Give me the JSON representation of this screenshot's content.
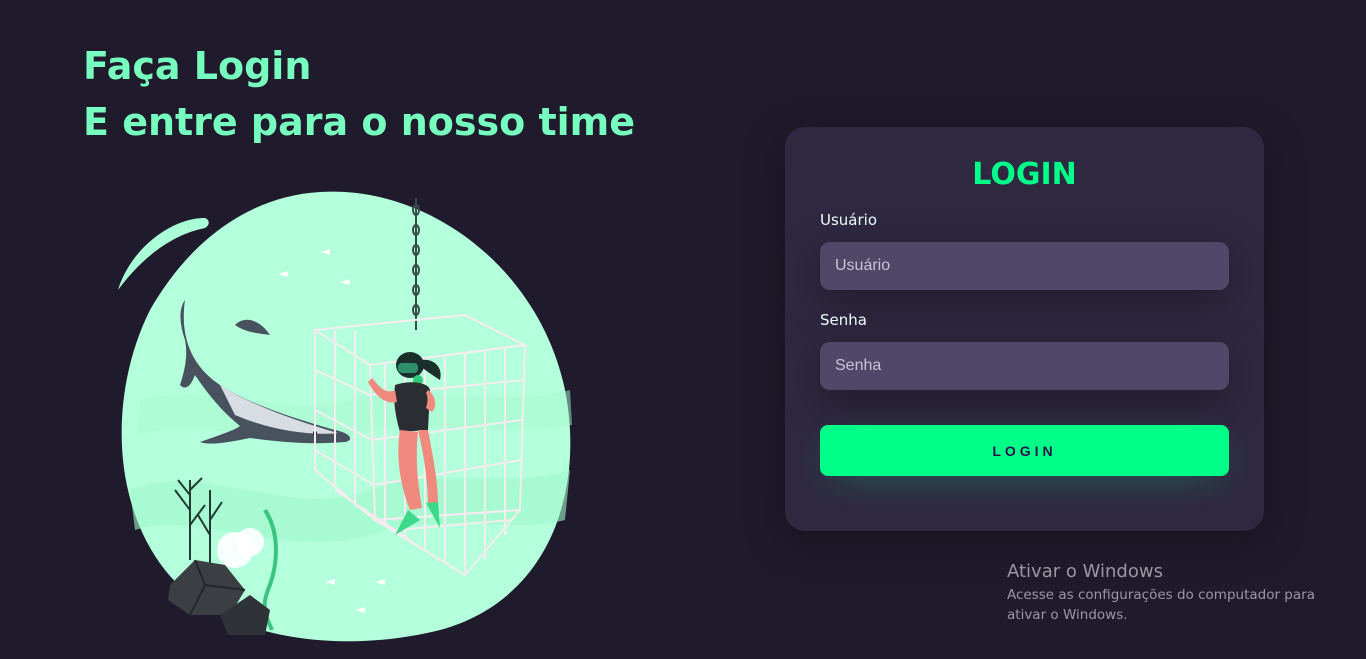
{
  "headline": {
    "line1": "Faça Login",
    "line2": "E entre para o nosso time"
  },
  "login_card": {
    "title": "LOGIN",
    "username_label": "Usuário",
    "username_placeholder": "Usuário",
    "password_label": "Senha",
    "password_placeholder": "Senha",
    "submit_label": "LOGIN"
  },
  "watermark": {
    "title": "Ativar o Windows",
    "line1": "Acesse as configurações do computador para",
    "line2": "ativar o Windows."
  },
  "colors": {
    "background": "#201b2c",
    "card": "#2f2841",
    "input": "#514869",
    "accent": "#00ff88",
    "headline": "#77ffc0"
  }
}
